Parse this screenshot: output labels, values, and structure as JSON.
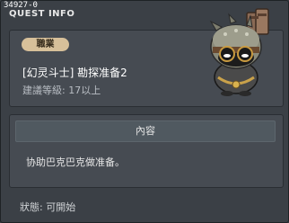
{
  "window": {
    "quest_id": "34927-0",
    "title": "QUEST INFO"
  },
  "header": {
    "job_badge": "職業",
    "quest_name": "[幻灵斗士] 勘探准备2",
    "required_level": "建議等級: 17以上",
    "npc_icon": "helmet-goggles-npc-portrait"
  },
  "content": {
    "header_label": "內容",
    "text": "协助巴克巴克做准备。"
  },
  "footer": {
    "status": "狀態: 可開始"
  },
  "colors": {
    "badge_bg": "#d7c09a",
    "panel_bg": "#464b52",
    "window_bg": "#3b4046"
  }
}
